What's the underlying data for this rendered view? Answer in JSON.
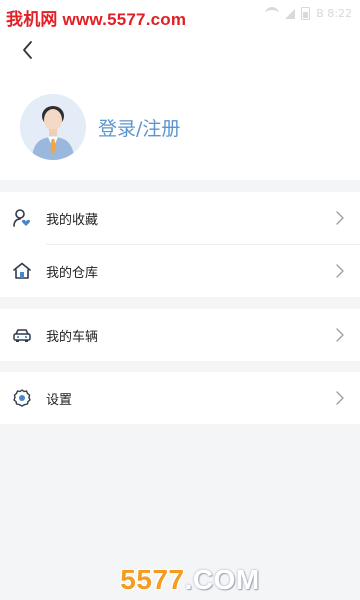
{
  "status_bar": {
    "watermark_text": "我机网 www.5577.com",
    "time_text": "B 8:22"
  },
  "header": {
    "back_icon": "chevron-left-icon",
    "avatar_icon": "user-avatar-icon",
    "login_label": "登录/注册"
  },
  "menu": {
    "group1": [
      {
        "label": "我的收藏",
        "icon": "user-heart-icon"
      },
      {
        "label": "我的仓库",
        "icon": "warehouse-home-icon"
      }
    ],
    "group2": [
      {
        "label": "我的车辆",
        "icon": "car-icon"
      }
    ],
    "group3": [
      {
        "label": "设置",
        "icon": "gear-icon"
      }
    ]
  },
  "watermark_bottom": {
    "number": "5577",
    "domain": ".COM"
  },
  "colors": {
    "accent": "#5b95cf",
    "icon_dark": "#2f3a4f",
    "icon_blue": "#4a86c8",
    "background": "#f4f5f7",
    "watermark_red": "#e31e24",
    "watermark_orange": "#f39c1f"
  }
}
